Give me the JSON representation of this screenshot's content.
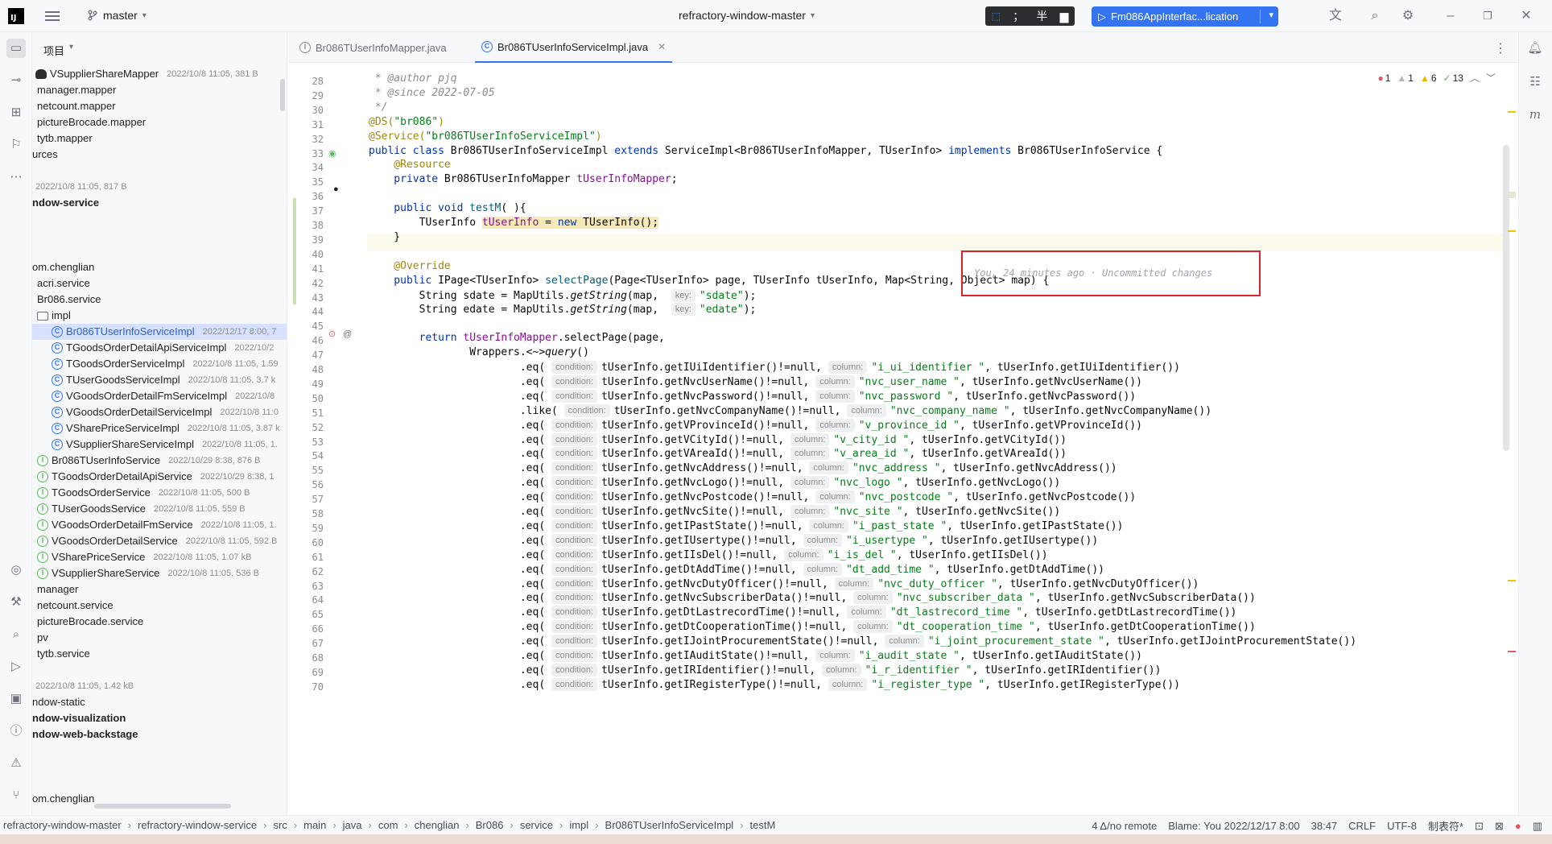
{
  "titlebar": {
    "logo": "IJ",
    "branch": "master",
    "project_title": "refractory-window-master",
    "ime": {
      "a": "中",
      "b": "；",
      "c": "半"
    },
    "run_config": "Fm086AppInterfac...lication"
  },
  "project_panel": {
    "header": "项目",
    "rows": [
      {
        "text": "VSupplierShareMapper",
        "meta": "2022/10/8 11:05, 381 B"
      },
      {
        "text": "manager.mapper"
      },
      {
        "text": "netcount.mapper"
      },
      {
        "text": "pictureBrocade.mapper"
      },
      {
        "text": "tytb.mapper"
      },
      {
        "text": "urces"
      },
      {
        "text": "",
        "meta": "2022/10/8 11:05, 817 B"
      },
      {
        "text": "ndow-service"
      },
      {
        "text": "om.chenglian"
      },
      {
        "text": "acri.service"
      },
      {
        "text": "Br086.service"
      },
      {
        "text": "impl"
      },
      {
        "text": "Br086TUserInfoServiceImpl",
        "meta": "2022/12/17 8:00, 7"
      },
      {
        "text": "TGoodsOrderDetailApiServiceImpl",
        "meta": "2022/10/2"
      },
      {
        "text": "TGoodsOrderServiceImpl",
        "meta": "2022/10/8 11:05, 1.59"
      },
      {
        "text": "TUserGoodsServiceImpl",
        "meta": "2022/10/8 11:05, 3.7 k"
      },
      {
        "text": "VGoodsOrderDetailFmServiceImpl",
        "meta": "2022/10/8"
      },
      {
        "text": "VGoodsOrderDetailServiceImpl",
        "meta": "2022/10/8 11:0"
      },
      {
        "text": "VSharePriceServiceImpl",
        "meta": "2022/10/8 11:05, 3.87 k"
      },
      {
        "text": "VSupplierShareServiceImpl",
        "meta": "2022/10/8 11:05, 1."
      },
      {
        "text": "Br086TUserInfoService",
        "meta": "2022/10/29 8:38, 876 B"
      },
      {
        "text": "TGoodsOrderDetailApiService",
        "meta": "2022/10/29 8:38, 1"
      },
      {
        "text": "TGoodsOrderService",
        "meta": "2022/10/8 11:05, 500 B"
      },
      {
        "text": "TUserGoodsService",
        "meta": "2022/10/8 11:05, 559 B"
      },
      {
        "text": "VGoodsOrderDetailFmService",
        "meta": "2022/10/8 11:05, 1."
      },
      {
        "text": "VGoodsOrderDetailService",
        "meta": "2022/10/8 11:05, 592 B"
      },
      {
        "text": "VSharePriceService",
        "meta": "2022/10/8 11:05, 1.07 kB"
      },
      {
        "text": "VSupplierShareService",
        "meta": "2022/10/8 11:05, 536 B"
      },
      {
        "text": "manager"
      },
      {
        "text": "netcount.service"
      },
      {
        "text": "pictureBrocade.service"
      },
      {
        "text": "pv"
      },
      {
        "text": "tytb.service"
      },
      {
        "text": "",
        "meta": "2022/10/8 11:05, 1.42 kB"
      },
      {
        "text": "ndow-static"
      },
      {
        "text": "ndow-visualization"
      },
      {
        "text": "ndow-web-backstage"
      },
      {
        "text": "om.chenglian"
      }
    ]
  },
  "tabs": [
    {
      "label": "Br086TUserInfoMapper.java"
    },
    {
      "label": "Br086TUserInfoServiceImpl.java"
    }
  ],
  "inspections": {
    "errors": "1",
    "warn_a": "1",
    "warn_b": "6",
    "ok": "13"
  },
  "editor": {
    "line_numbers": [
      "28",
      "29",
      "30",
      "31",
      "32",
      "33",
      "34",
      "35",
      "36",
      "37",
      "38",
      "39",
      "40",
      "41",
      "42",
      "43",
      "44",
      "45",
      "46",
      "47",
      "48",
      "49",
      "50",
      "51",
      "52",
      "53",
      "54",
      "55",
      "56",
      "57",
      "58",
      "59",
      "60",
      "61",
      "62",
      "63",
      "64",
      "65",
      "66",
      "67",
      "68",
      "69",
      "70"
    ],
    "l28": " * @author pjq",
    "l29a": " * ",
    "l29b": "@since",
    "l29c": " 2022-07-05",
    "l30": " */",
    "l31a": "@DS(",
    "l31b": "\"br086\"",
    "l31c": ")",
    "l32a": "@Service(",
    "l32b": "\"br086TUserInfoServiceImpl\"",
    "l32c": ")",
    "l33a": "public class",
    "l33b": " Br086TUserInfoServiceImpl ",
    "l33c": "extends",
    "l33d": " ServiceImpl<Br086TUserInfoMapper, TUserInfo> ",
    "l33e": "implements",
    "l33f": " Br086TUserInfoService {",
    "l34": "    @Resource",
    "l35a": "    private",
    "l35b": " Br086TUserInfoMapper ",
    "l35c": "tUserInfoMapper",
    "l35d": ";",
    "l37a": "    public void",
    "l37b": " testM",
    "l37c": "( ){",
    "l38a": "        TUserInfo ",
    "l38b": "tUserInfo",
    "l38c": " = ",
    "l38d": "new",
    "l38e": " TUserInfo();",
    "blame_hint": "You, 24 minutes ago · Uncommitted changes",
    "l39": "    }",
    "l41": "    @Override",
    "l42a": "    public",
    "l42b": " IPage<TUserInfo> ",
    "l42c": "selectPage",
    "l42d": "(Page<TUserInfo> page, TUserInfo tUserInfo, Map<String, Object> map) {",
    "l43a": "        String sdate = MapUtils.",
    "l43b": "getString",
    "l43c": "(map,  ",
    "l43h": "key:",
    "l43d": "\"sdate\"",
    "l43e": ");",
    "l44a": "        String edate = MapUtils.",
    "l44b": "getString",
    "l44c": "(map,  ",
    "l44h": "key:",
    "l44d": "\"edate\"",
    "l44e": ");",
    "l46a": "        return",
    "l46b": " tUserInfoMapper",
    "l46c": ".selectPage(page,",
    "l47a": "                Wrappers.",
    "l47b": "<~>query",
    "l47c": "()",
    "eq_rows": [
      {
        "op": ".eq(",
        "getter": "tUserInfo.getIUiIdentifier()!=null,",
        "col": "\"i_ui_identifier \"",
        "tail": ", tUserInfo.getIUiIdentifier())"
      },
      {
        "op": ".eq(",
        "getter": "tUserInfo.getNvcUserName()!=null,",
        "col": "\"nvc_user_name \"",
        "tail": ", tUserInfo.getNvcUserName())"
      },
      {
        "op": ".eq(",
        "getter": "tUserInfo.getNvcPassword()!=null,",
        "col": "\"nvc_password \"",
        "tail": ", tUserInfo.getNvcPassword())"
      },
      {
        "op": ".like(",
        "getter": "tUserInfo.getNvcCompanyName()!=null,",
        "col": "\"nvc_company_name \"",
        "tail": ", tUserInfo.getNvcCompanyName())"
      },
      {
        "op": ".eq(",
        "getter": "tUserInfo.getVProvinceId()!=null,",
        "col": "\"v_province_id \"",
        "tail": ", tUserInfo.getVProvinceId())"
      },
      {
        "op": ".eq(",
        "getter": "tUserInfo.getVCityId()!=null,",
        "col": "\"v_city_id \"",
        "tail": ", tUserInfo.getVCityId())"
      },
      {
        "op": ".eq(",
        "getter": "tUserInfo.getVAreaId()!=null,",
        "col": "\"v_area_id \"",
        "tail": ", tUserInfo.getVAreaId())"
      },
      {
        "op": ".eq(",
        "getter": "tUserInfo.getNvcAddress()!=null,",
        "col": "\"nvc_address \"",
        "tail": ", tUserInfo.getNvcAddress())"
      },
      {
        "op": ".eq(",
        "getter": "tUserInfo.getNvcLogo()!=null,",
        "col": "\"nvc_logo \"",
        "tail": ", tUserInfo.getNvcLogo())"
      },
      {
        "op": ".eq(",
        "getter": "tUserInfo.getNvcPostcode()!=null,",
        "col": "\"nvc_postcode \"",
        "tail": ", tUserInfo.getNvcPostcode())"
      },
      {
        "op": ".eq(",
        "getter": "tUserInfo.getNvcSite()!=null,",
        "col": "\"nvc_site \"",
        "tail": ", tUserInfo.getNvcSite())"
      },
      {
        "op": ".eq(",
        "getter": "tUserInfo.getIPastState()!=null,",
        "col": "\"i_past_state \"",
        "tail": ", tUserInfo.getIPastState())"
      },
      {
        "op": ".eq(",
        "getter": "tUserInfo.getIUsertype()!=null,",
        "col": "\"i_usertype \"",
        "tail": ", tUserInfo.getIUsertype())"
      },
      {
        "op": ".eq(",
        "getter": "tUserInfo.getIIsDel()!=null,",
        "col": "\"i_is_del \"",
        "tail": ", tUserInfo.getIIsDel())"
      },
      {
        "op": ".eq(",
        "getter": "tUserInfo.getDtAddTime()!=null,",
        "col": "\"dt_add_time \"",
        "tail": ", tUserInfo.getDtAddTime())"
      },
      {
        "op": ".eq(",
        "getter": "tUserInfo.getNvcDutyOfficer()!=null,",
        "col": "\"nvc_duty_officer \"",
        "tail": ", tUserInfo.getNvcDutyOfficer())"
      },
      {
        "op": ".eq(",
        "getter": "tUserInfo.getNvcSubscriberData()!=null,",
        "col": "\"nvc_subscriber_data \"",
        "tail": ", tUserInfo.getNvcSubscriberData())"
      },
      {
        "op": ".eq(",
        "getter": "tUserInfo.getDtLastrecordTime()!=null,",
        "col": "\"dt_lastrecord_time \"",
        "tail": ", tUserInfo.getDtLastrecordTime())"
      },
      {
        "op": ".eq(",
        "getter": "tUserInfo.getDtCooperationTime()!=null,",
        "col": "\"dt_cooperation_time \"",
        "tail": ", tUserInfo.getDtCooperationTime())"
      },
      {
        "op": ".eq(",
        "getter": "tUserInfo.getIJointProcurementState()!=null,",
        "col": "\"i_joint_procurement_state \"",
        "tail": ", tUserInfo.getIJointProcurementState())"
      },
      {
        "op": ".eq(",
        "getter": "tUserInfo.getIAuditState()!=null,",
        "col": "\"i_audit_state \"",
        "tail": ", tUserInfo.getIAuditState())"
      },
      {
        "op": ".eq(",
        "getter": "tUserInfo.getIRIdentifier()!=null,",
        "col": "\"i_r_identifier \"",
        "tail": ", tUserInfo.getIRIdentifier())"
      },
      {
        "op": ".eq(",
        "getter": "tUserInfo.getIRegisterType()!=null,",
        "col": "\"i_register_type \"",
        "tail": ", tUserInfo.getIRegisterType())"
      }
    ],
    "condition_hint": "condition:",
    "column_hint": "column:"
  },
  "statusbar": {
    "crumbs": [
      "refractory-window-master",
      "refractory-window-service",
      "src",
      "main",
      "java",
      "com",
      "chenglian",
      "Br086",
      "service",
      "impl",
      "Br086TUserInfoServiceImpl",
      "testM"
    ],
    "vcs": "4 Δ/no remote",
    "blame": "Blame: You 2022/12/17 8:00",
    "position": "38:47",
    "line_sep": "CRLF",
    "encoding": "UTF-8",
    "indent": "制表符*"
  }
}
